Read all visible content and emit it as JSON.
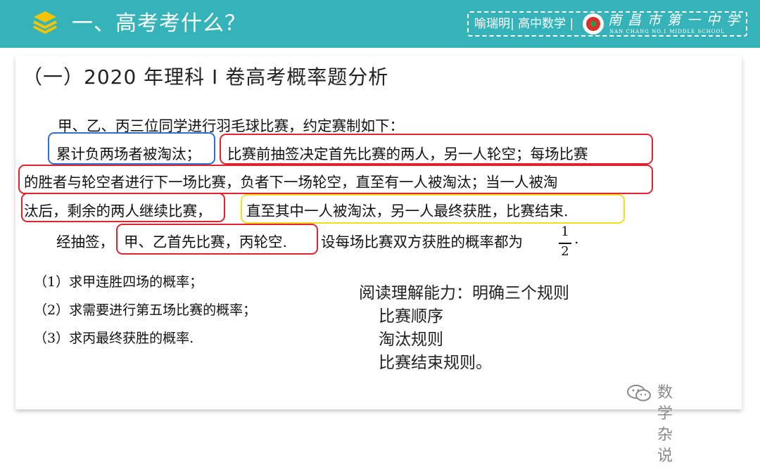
{
  "header": {
    "title": "一、高考考什么？",
    "credit": "喻瑞明| 高中数学 |",
    "school_name": "南昌市第一中学",
    "school_name_en": "NAN CHANG NO.1 MIDDLE SCHOOL",
    "icon": "stack-layers-icon"
  },
  "section_title": "（一）2020 年理科 I 卷高考概率题分析",
  "problem": {
    "line1": "甲、乙、丙三位同学进行羽毛球比赛，约定赛制如下：",
    "line2a": "累计负两场者被淘汰；",
    "line2b": "比赛前抽签决定首先比赛的两人，另一人轮空；每场比赛",
    "line3": "的胜者与轮空者进行下一场比赛，负者下一场轮空，直至有一人被淘汰；当一人被淘",
    "line4a": "汰后，剩余的两人继续比赛，",
    "line4b": "直至其中一人被淘汰，另一人最终获胜，比赛结束.",
    "line5a": "经抽签，",
    "line5b": "甲、乙首先比赛，丙轮空.",
    "line5c": "设每场比赛双方获胜的概率都为",
    "frac_num": "1",
    "frac_den": "2",
    "line5_end": "."
  },
  "questions": [
    "（1）求甲连胜四场的概率；",
    "（2）求需要进行第五场比赛的概率；",
    "（3）求丙最终获胜的概率."
  ],
  "analysis": {
    "heading": "阅读理解能力：明确三个规则",
    "items": [
      "比赛顺序",
      "淘汰规则",
      "比赛结束规则。"
    ]
  },
  "watermark": {
    "text": "数学杂说",
    "icon": "wechat-icon"
  },
  "colors": {
    "header_bg": "#36b3b8",
    "highlight_red": "#e0232e",
    "highlight_blue": "#2f6fd0",
    "highlight_yellow": "#f2dd20"
  }
}
